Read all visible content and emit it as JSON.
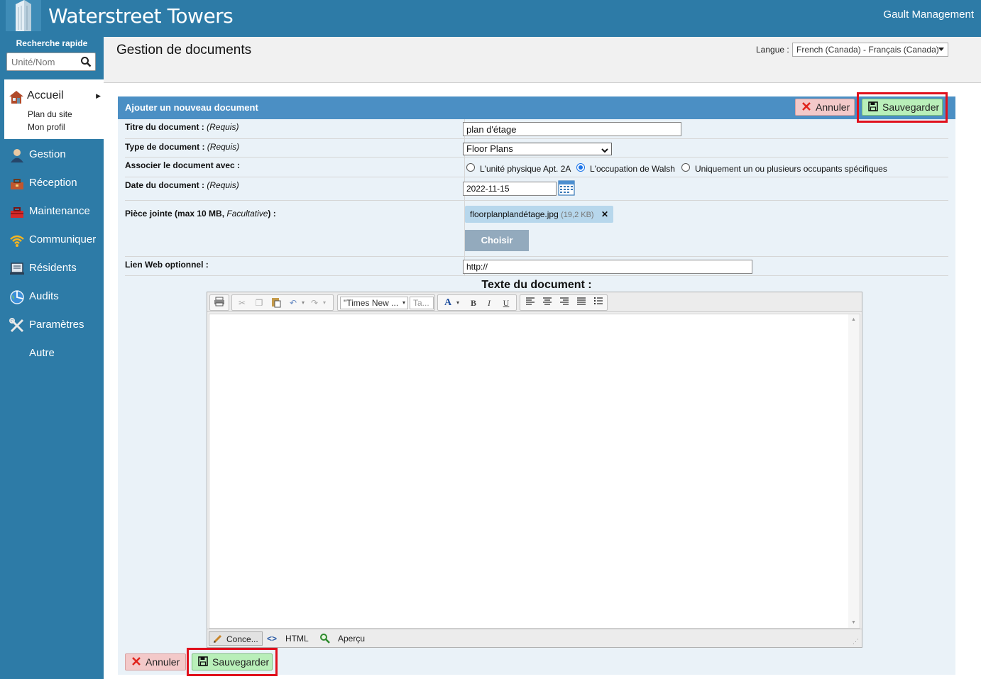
{
  "header": {
    "app_title": "Waterstreet Towers",
    "company": "Gault Management"
  },
  "sidebar": {
    "quick_search_label": "Recherche rapide",
    "quick_search_placeholder": "Unité/Nom",
    "home": {
      "label": "Accueil",
      "subitems": [
        "Plan du site",
        "Mon profil"
      ]
    },
    "items": [
      {
        "label": "Gestion",
        "icon": "person-icon"
      },
      {
        "label": "Réception",
        "icon": "toolbox-icon"
      },
      {
        "label": "Maintenance",
        "icon": "toolbox-red-icon"
      },
      {
        "label": "Communiquer",
        "icon": "wifi-icon"
      },
      {
        "label": "Résidents",
        "icon": "residents-icon"
      },
      {
        "label": "Audits",
        "icon": "globe-icon"
      },
      {
        "label": "Paramètres",
        "icon": "tools-icon"
      },
      {
        "label": "Autre",
        "icon": ""
      }
    ]
  },
  "page": {
    "title": "Gestion de documents",
    "language_label": "Langue :",
    "language_value": "French (Canada) - Français (Canada)"
  },
  "panel": {
    "heading": "Ajouter un nouveau document",
    "cancel_label": "Annuler",
    "save_label": "Sauvegarder"
  },
  "form": {
    "title_label": "Titre du document :",
    "title_req": "(Requis)",
    "title_value": "plan d'étage",
    "type_label": "Type de document :",
    "type_req": "(Requis)",
    "type_value": "Floor Plans",
    "assoc_label": "Associer le document avec :",
    "assoc_options": [
      {
        "label": "L'unité physique Apt. 2A",
        "checked": false
      },
      {
        "label": "L'occupation de Walsh",
        "checked": true
      },
      {
        "label": "Uniquement un ou plusieurs occupants spécifiques",
        "checked": false
      }
    ],
    "date_label": "Date du document :",
    "date_req": "(Requis)",
    "date_value": "2022-11-15",
    "attach_label_a": "Pièce jointe (max 10 MB, ",
    "attach_label_opt": "Facultative",
    "attach_label_b": ") :",
    "attach_file_name": "floorplanplandétage.jpg",
    "attach_file_size": "(19,2 KB)",
    "attach_remove": "✕",
    "choose_label": "Choisir",
    "weblink_label": "Lien Web optionnel :",
    "weblink_value": "http://",
    "doc_text_label": "Texte du document :"
  },
  "editor": {
    "font_family": "\"Times New ...",
    "font_size": "Ta...",
    "mode_design": "Conce...",
    "mode_html": "HTML",
    "mode_preview": "Aperçu"
  },
  "footer": {
    "cancel_label": "Annuler",
    "save_label": "Sauvegarder"
  },
  "colors": {
    "brand": "#2d7ba7",
    "panel_bar": "#4b8fc4",
    "save_bg": "#b9efb9",
    "cancel_bg": "#f3c9c9",
    "highlight": "#e0101c"
  }
}
